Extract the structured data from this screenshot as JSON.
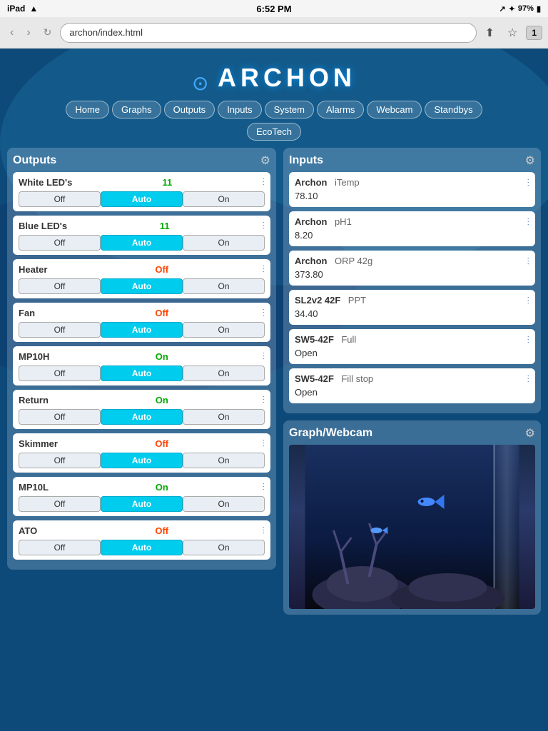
{
  "statusBar": {
    "left": "iPad",
    "time": "6:52 PM",
    "signal": "97%",
    "wifiIcon": "wifi",
    "batteryIcon": "battery"
  },
  "browserBar": {
    "url": "archon/index.html",
    "backDisabled": false,
    "forwardDisabled": false,
    "tabCount": "1"
  },
  "logo": {
    "text": "ARCHON"
  },
  "nav": {
    "items": [
      {
        "label": "Home"
      },
      {
        "label": "Graphs"
      },
      {
        "label": "Outputs"
      },
      {
        "label": "Inputs"
      },
      {
        "label": "System"
      },
      {
        "label": "Alarms"
      },
      {
        "label": "Webcam"
      },
      {
        "label": "Standbys"
      }
    ],
    "ecotech": "EcoTech"
  },
  "outputs": {
    "title": "Outputs",
    "items": [
      {
        "name": "White LED's",
        "value": "11",
        "valueClass": "green",
        "ctrl": {
          "off": "Off",
          "auto": "Auto",
          "on": "On"
        }
      },
      {
        "name": "Blue LED's",
        "value": "11",
        "valueClass": "green",
        "ctrl": {
          "off": "Off",
          "auto": "Auto",
          "on": "On"
        }
      },
      {
        "name": "Heater",
        "value": "Off",
        "valueClass": "red",
        "ctrl": {
          "off": "Off",
          "auto": "Auto",
          "on": "On"
        }
      },
      {
        "name": "Fan",
        "value": "Off",
        "valueClass": "red",
        "ctrl": {
          "off": "Off",
          "auto": "Auto",
          "on": "On"
        }
      },
      {
        "name": "MP10H",
        "value": "On",
        "valueClass": "green",
        "ctrl": {
          "off": "Off",
          "auto": "Auto",
          "on": "On"
        }
      },
      {
        "name": "Return",
        "value": "On",
        "valueClass": "green",
        "ctrl": {
          "off": "Off",
          "auto": "Auto",
          "on": "On"
        }
      },
      {
        "name": "Skimmer",
        "value": "Off",
        "valueClass": "red",
        "ctrl": {
          "off": "Off",
          "auto": "Auto",
          "on": "On"
        }
      },
      {
        "name": "MP10L",
        "value": "On",
        "valueClass": "green",
        "ctrl": {
          "off": "Off",
          "auto": "Auto",
          "on": "On"
        }
      },
      {
        "name": "ATO",
        "value": "Off",
        "valueClass": "red",
        "ctrl": {
          "off": "Off",
          "auto": "Auto",
          "on": "On"
        }
      }
    ]
  },
  "inputs": {
    "title": "Inputs",
    "items": [
      {
        "source": "Archon",
        "label": "iTemp",
        "value": "78.10"
      },
      {
        "source": "Archon",
        "label": "pH1",
        "value": "8.20"
      },
      {
        "source": "Archon",
        "label": "ORP 42g",
        "value": "373.80"
      },
      {
        "source": "SL2v2 42F",
        "label": "PPT",
        "value": "34.40"
      },
      {
        "source": "SW5-42F",
        "label": "Full",
        "value": "Open"
      },
      {
        "source": "SW5-42F",
        "label": "Fill stop",
        "value": "Open"
      }
    ]
  },
  "webcam": {
    "title": "Graph/Webcam"
  },
  "labels": {
    "off": "Off",
    "auto": "Auto",
    "on": "On"
  }
}
